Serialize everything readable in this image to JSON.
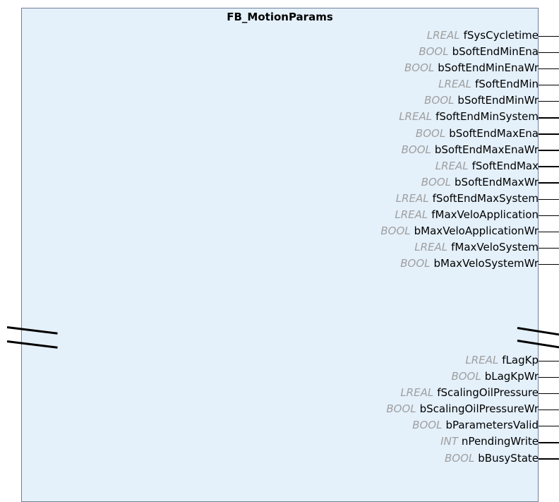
{
  "block": {
    "title": "FB_MotionParams",
    "outputs_upper": [
      {
        "type": "LREAL",
        "name": "fSysCycletime"
      },
      {
        "type": "BOOL",
        "name": "bSoftEndMinEna"
      },
      {
        "type": "BOOL",
        "name": "bSoftEndMinEnaWr"
      },
      {
        "type": "LREAL",
        "name": "fSoftEndMin"
      },
      {
        "type": "BOOL",
        "name": "bSoftEndMinWr"
      },
      {
        "type": "LREAL",
        "name": "fSoftEndMinSystem"
      },
      {
        "type": "BOOL",
        "name": "bSoftEndMaxEna"
      },
      {
        "type": "BOOL",
        "name": "bSoftEndMaxEnaWr"
      },
      {
        "type": "LREAL",
        "name": "fSoftEndMax"
      },
      {
        "type": "BOOL",
        "name": "bSoftEndMaxWr"
      },
      {
        "type": "LREAL",
        "name": "fSoftEndMaxSystem"
      },
      {
        "type": "LREAL",
        "name": "fMaxVeloApplication"
      },
      {
        "type": "BOOL",
        "name": "bMaxVeloApplicationWr"
      },
      {
        "type": "LREAL",
        "name": "fMaxVeloSystem"
      },
      {
        "type": "BOOL",
        "name": "bMaxVeloSystemWr"
      }
    ],
    "outputs_lower": [
      {
        "type": "LREAL",
        "name": "fLagKp"
      },
      {
        "type": "BOOL",
        "name": "bLagKpWr"
      },
      {
        "type": "LREAL",
        "name": "fScalingOilPressure"
      },
      {
        "type": "BOOL",
        "name": "bScalingOilPressureWr"
      },
      {
        "type": "BOOL",
        "name": "bParametersValid"
      },
      {
        "type": "INT",
        "name": "nPendingWrite"
      },
      {
        "type": "BOOL",
        "name": "bBusyState"
      }
    ]
  },
  "colors": {
    "block_fill": "#e4f0fa",
    "block_border": "#6f8299",
    "type_text": "#9f9f9f",
    "name_text": "#000000"
  }
}
